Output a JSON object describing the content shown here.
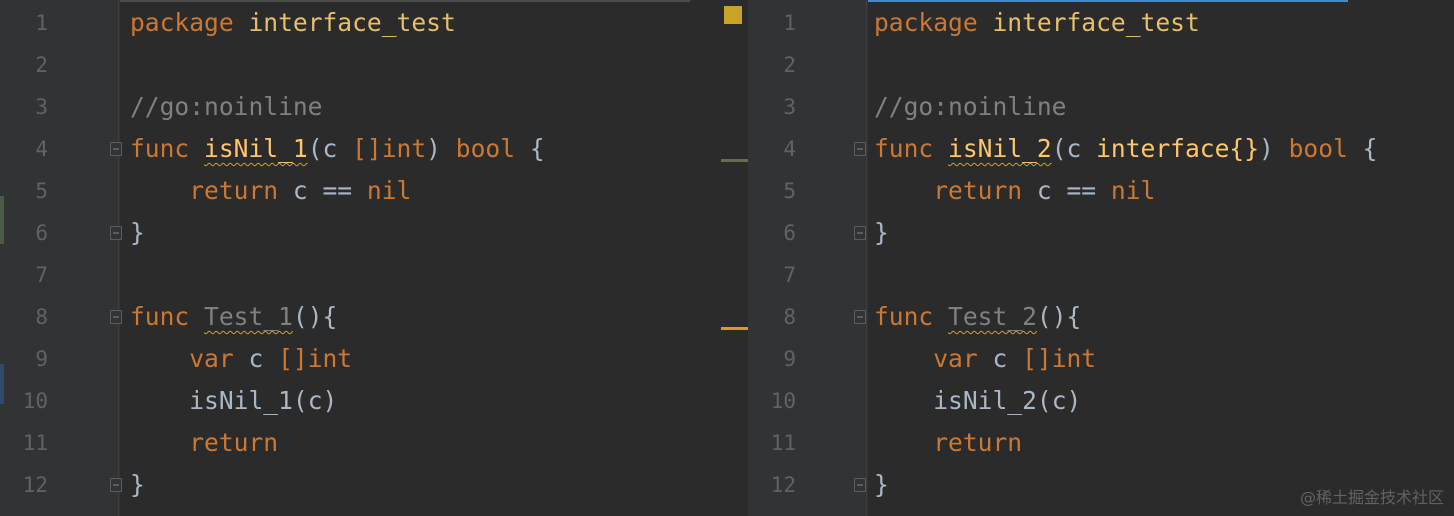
{
  "colors": {
    "background": "#2b2b2b",
    "gutter": "#313335",
    "keyword": "#cc7832",
    "function": "#ffc66d",
    "comment": "#808080",
    "identifier": "#a9b7c6",
    "warning": "#c9a227",
    "active_tab": "#4a88c7"
  },
  "left_editor": {
    "line_numbers": [
      "1",
      "2",
      "3",
      "4",
      "5",
      "6",
      "7",
      "8",
      "9",
      "10",
      "11",
      "12"
    ],
    "lines": {
      "l1_kw": "package",
      "l1_name": "interface_test",
      "l3_comment": "//go:noinline",
      "l4_kw": "func",
      "l4_name": "isNil_1",
      "l4_open": "(c ",
      "l4_type": "[]int",
      "l4_close": ") ",
      "l4_ret": "bool",
      "l4_brace": " {",
      "l5_kw": "return",
      "l5_expr": " c == ",
      "l5_nil": "nil",
      "l6": "}",
      "l8_kw": "func",
      "l8_name": "Test_1",
      "l8_rest": "(){",
      "l9_kw": "var",
      "l9_var": " c ",
      "l9_type": "[]int",
      "l10_call": "isNil_1",
      "l10_args": "(c)",
      "l11_kw": "return",
      "l12": "}"
    }
  },
  "right_editor": {
    "line_numbers": [
      "1",
      "2",
      "3",
      "4",
      "5",
      "6",
      "7",
      "8",
      "9",
      "10",
      "11",
      "12"
    ],
    "lines": {
      "l1_kw": "package",
      "l1_name": "interface_test",
      "l3_comment": "//go:noinline",
      "l4_kw": "func",
      "l4_name": "isNil_2",
      "l4_open": "(c ",
      "l4_type": "interface{}",
      "l4_close": ") ",
      "l4_ret": "bool",
      "l4_brace": " {",
      "l5_kw": "return",
      "l5_expr": " c == ",
      "l5_nil": "nil",
      "l6": "}",
      "l8_kw": "func",
      "l8_name": "Test_2",
      "l8_rest": "(){",
      "l9_kw": "var",
      "l9_var": " c ",
      "l9_type": "[]int",
      "l10_call": "isNil_2",
      "l10_args": "(c)",
      "l11_kw": "return",
      "l12": "}"
    }
  },
  "watermark": "@稀土掘金技术社区"
}
